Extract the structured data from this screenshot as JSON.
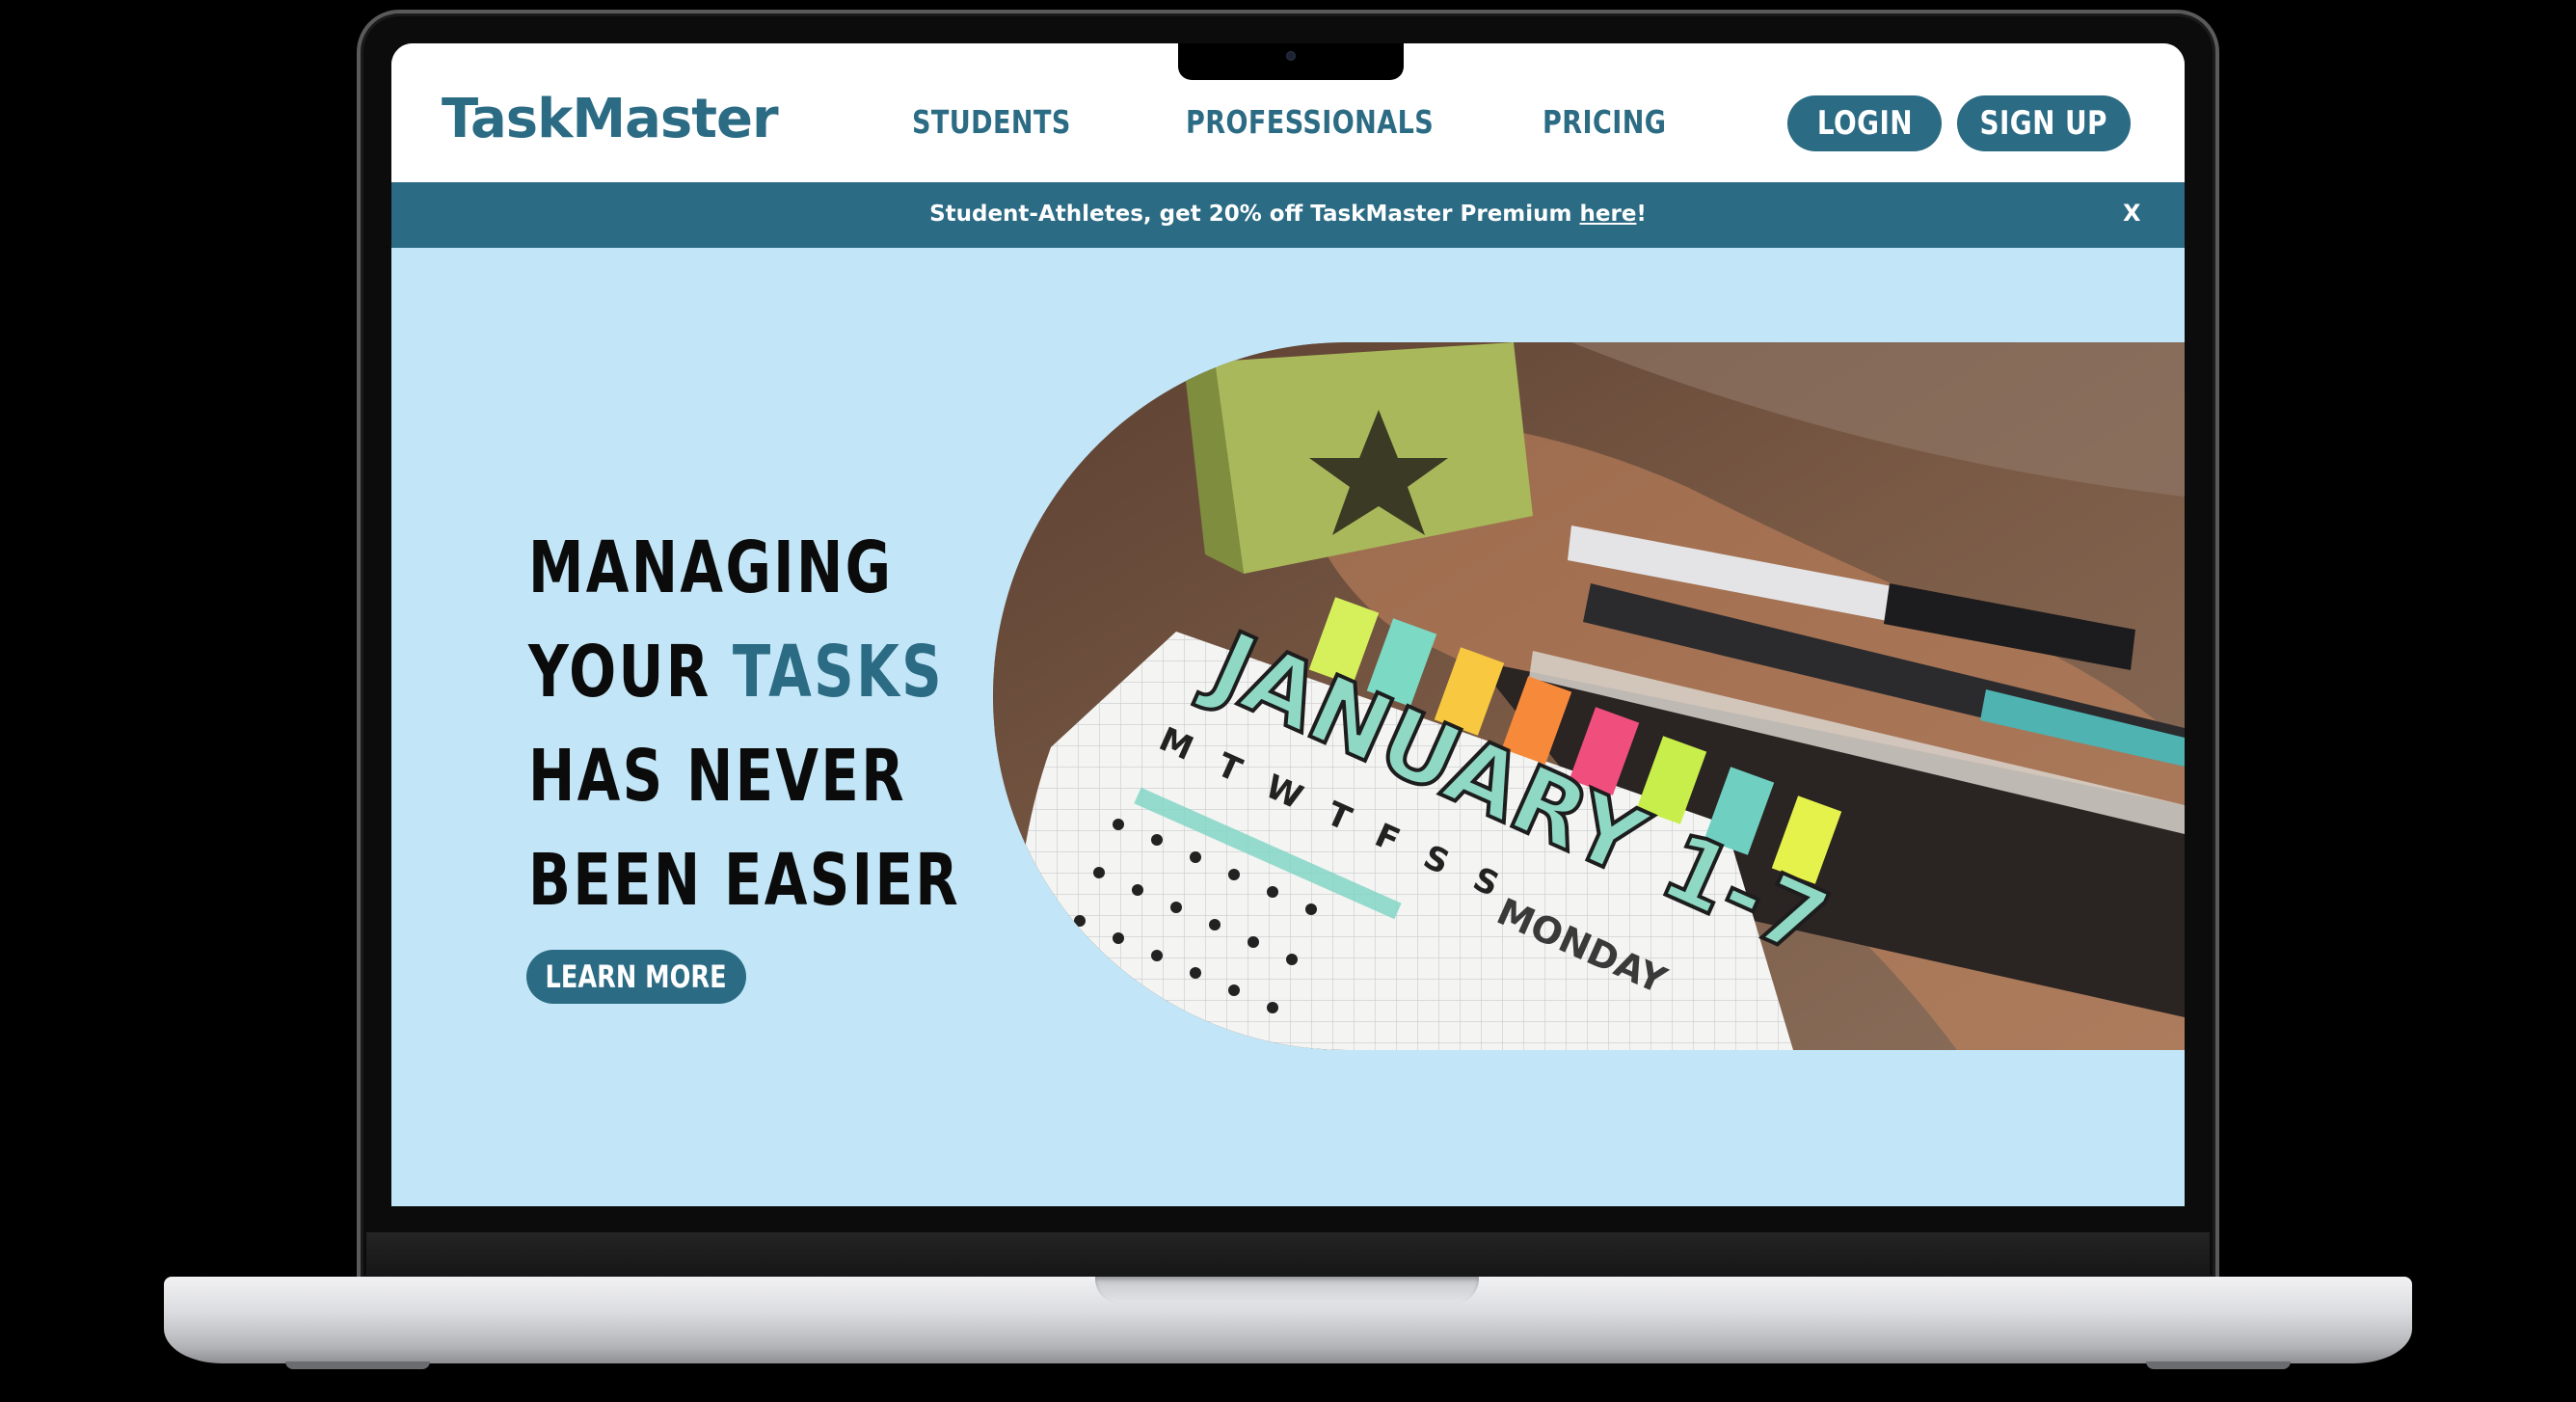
{
  "site": {
    "logo": "TaskMaster",
    "brand_color": "#2b6b84",
    "hero_bg_color": "#c2e6f7"
  },
  "nav": {
    "items": [
      {
        "label": "STUDENTS"
      },
      {
        "label": "PROFESSIONALS"
      },
      {
        "label": "PRICING"
      }
    ],
    "login_label": "LOGIN",
    "signup_label": "SIGN UP"
  },
  "promo": {
    "text_before": "Student-Athletes, get 20% off TaskMaster Premium ",
    "link_text": "here",
    "text_after": "!",
    "close_label": "X"
  },
  "hero": {
    "line1": "MANAGING",
    "line2_prefix": "YOUR ",
    "line2_accent": "TASKS",
    "line3": "HAS NEVER",
    "line4": "BEEN EASIER",
    "button_label": "LEARN MORE",
    "image": {
      "calendar_month": "JANUARY 1-7",
      "weekdays": "M T W T F S S",
      "day_label": "MONDAY"
    }
  }
}
